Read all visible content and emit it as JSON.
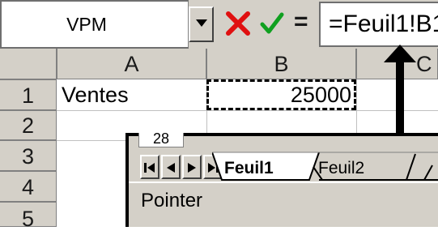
{
  "name_box": {
    "value": "VPM"
  },
  "formula_bar": {
    "cancel_icon": "x-icon",
    "enter_icon": "check-icon",
    "equals": "=",
    "formula": "=Feuil1!B1"
  },
  "grid": {
    "columns": [
      "A",
      "B",
      "C"
    ],
    "rows": [
      "1",
      "2",
      "3",
      "4",
      "5"
    ],
    "cells": {
      "A1": "Ventes",
      "B1": "25000"
    }
  },
  "sheet_tabs": {
    "hidden_row": "28",
    "tabs": [
      "Feuil1",
      "Feuil2"
    ],
    "active_tab": "Feuil1"
  },
  "status_bar": {
    "mode": "Pointer"
  },
  "colors": {
    "cancel": "#e01010",
    "enter": "#10a020",
    "chrome": "#d4d0c8"
  }
}
